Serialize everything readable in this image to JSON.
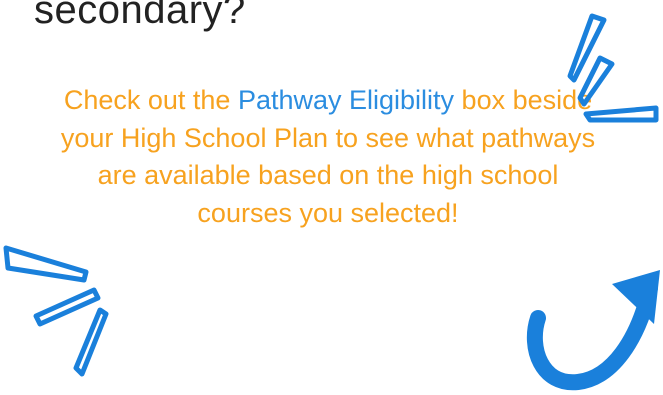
{
  "heading": "secondary?",
  "message": {
    "before_link": "Check out the ",
    "link_text": "Pathway Eligibility",
    "after_link": " box beside your High School Plan to see what pathways are available based on the high school courses you selected!"
  },
  "colors": {
    "heading": "#222222",
    "message": "#f7a21f",
    "link": "#2b8de0",
    "doodle": "#1a80db"
  },
  "icons": {
    "top_right_accent": "burst-lines-icon",
    "left_accent": "burst-lines-icon",
    "bottom_right_arrow": "curved-arrow-icon"
  }
}
